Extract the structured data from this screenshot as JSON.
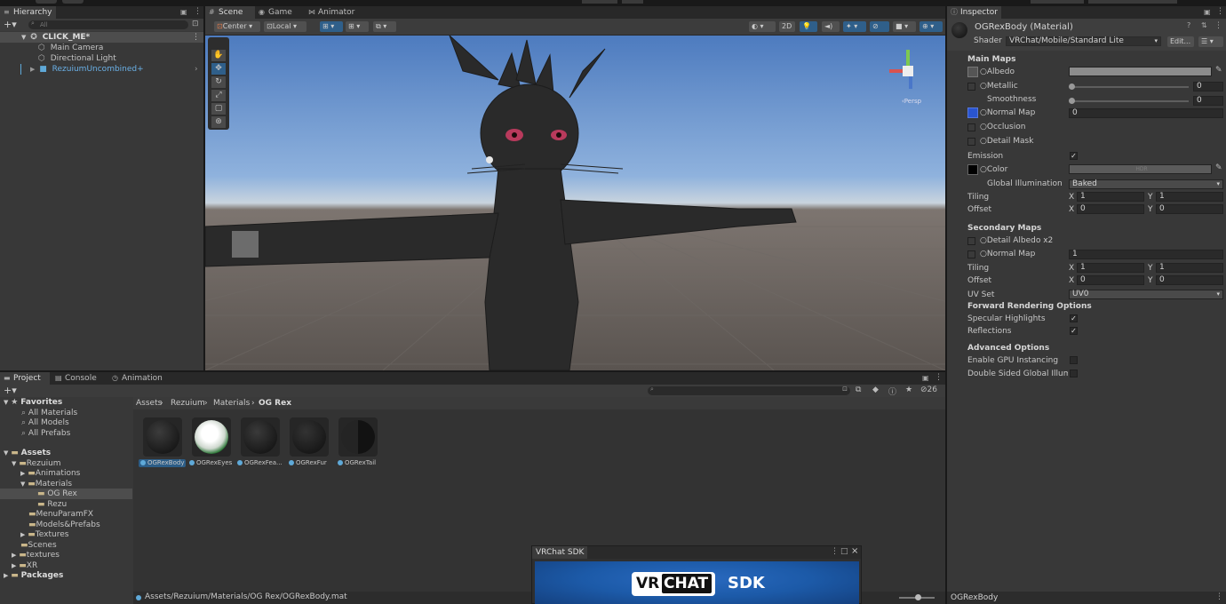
{
  "hierarchy": {
    "tab": "Hierarchy",
    "search_placeholder": "All",
    "scene": "CLICK_ME*",
    "items": [
      "Main Camera",
      "Directional Light",
      "RezuiumUncombined+"
    ]
  },
  "scene_view": {
    "tabs": [
      "Scene",
      "Game",
      "Animator"
    ],
    "pivot": "Center",
    "space": "Local",
    "mode_2d": "2D",
    "gizmo_label": "‹Persp"
  },
  "inspector": {
    "tab": "Inspector",
    "material_name": "OGRexBody (Material)",
    "shader_label": "Shader",
    "shader_value": "VRChat/Mobile/Standard Lite",
    "edit_button": "Edit...",
    "main_maps": "Main Maps",
    "albedo": "Albedo",
    "metallic": "Metallic",
    "metallic_value": "0",
    "smoothness": "Smoothness",
    "smoothness_value": "0",
    "normal_map": "Normal Map",
    "normal_map_value": "0",
    "occlusion": "Occlusion",
    "detail_mask": "Detail Mask",
    "emission": "Emission",
    "color": "Color",
    "color_field_text": "HDR",
    "global_illumination": "Global Illumination",
    "gi_value": "Baked",
    "tiling": "Tiling",
    "offset": "Offset",
    "x_label": "X",
    "y_label": "Y",
    "tiling_x": "1",
    "tiling_y": "1",
    "offset_x": "0",
    "offset_y": "0",
    "secondary_maps": "Secondary Maps",
    "detail_albedo": "Detail Albedo x2",
    "normal_map2": "Normal Map",
    "normal_map2_value": "1",
    "tiling2_x": "1",
    "tiling2_y": "1",
    "offset2_x": "0",
    "offset2_y": "0",
    "uv_set": "UV Set",
    "uv_value": "UV0",
    "forward_rendering": "Forward Rendering Options",
    "specular": "Specular Highlights",
    "reflections": "Reflections",
    "advanced": "Advanced Options",
    "gpu_instancing": "Enable GPU Instancing",
    "double_sided": "Double Sided Global Illumina",
    "footer": "OGRexBody"
  },
  "project": {
    "tabs": [
      "Project",
      "Console",
      "Animation"
    ],
    "badge_count": "26",
    "breadcrumb": [
      "Assets",
      "Rezuium",
      "Materials",
      "OG Rex"
    ],
    "tree": [
      {
        "label": "Favorites",
        "bold": true
      },
      {
        "label": "All Materials"
      },
      {
        "label": "All Models"
      },
      {
        "label": "All Prefabs"
      },
      {
        "label": "Assets",
        "bold": true
      },
      {
        "label": "Rezuium"
      },
      {
        "label": "Animations"
      },
      {
        "label": "Materials"
      },
      {
        "label": "OG Rex"
      },
      {
        "label": "Rezu"
      },
      {
        "label": "MenuParamFX"
      },
      {
        "label": "Models&Prefabs"
      },
      {
        "label": "Textures"
      },
      {
        "label": "Scenes"
      },
      {
        "label": "textures"
      },
      {
        "label": "XR"
      },
      {
        "label": "Packages",
        "bold": true
      }
    ],
    "assets": [
      "OGRexBody",
      "OGRexEyes",
      "OGRexFea...",
      "OGRexFur",
      "OGRexTail"
    ],
    "status_path": "Assets/Rezuium/Materials/OG Rex/OGRexBody.mat"
  },
  "vrchat_sdk": {
    "title": "VRChat SDK",
    "logo_vr": "VR",
    "logo_chat": "CHAT",
    "logo_sdk": "SDK"
  },
  "colors": {
    "panel": "#383838",
    "tabbar": "#282828",
    "selection": "#2c5d87",
    "link_blue": "#6ab0e6",
    "sky_top": "#4d7bbf",
    "ground": "#5a5450",
    "sdk_blue": "#1c5aa8"
  }
}
